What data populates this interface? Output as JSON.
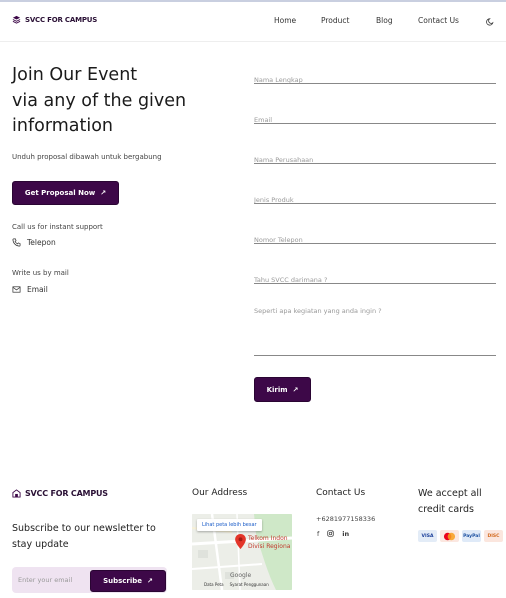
{
  "nav": {
    "brand": "SVCC FOR CAMPUS",
    "links": [
      "Home",
      "Product",
      "Blog",
      "Contact Us"
    ]
  },
  "hero": {
    "title_lines": [
      "Join Our Event",
      "via any of the given",
      "information"
    ],
    "subtitle": "Unduh proposal dibawah untuk bergabung",
    "proposal_button": "Get Proposal Now",
    "call_label": "Call us for instant support",
    "phone_label": "Telepon",
    "mail_label": "Write us by mail",
    "email_label": "Email"
  },
  "form": {
    "placeholders": {
      "name": "Nama Lengkap",
      "email": "Email",
      "company": "Nama Perusahaan",
      "product": "Jenis Produk",
      "phone": "Nomor Telepon",
      "source": "Tahu SVCC darimana ?",
      "activity": "Seperti apa kegiatan yang anda ingin ?"
    },
    "submit_label": "Kirim"
  },
  "footer": {
    "brand": "SVCC FOR CAMPUS",
    "newsletter_title": "Subscribe to our newsletter to stay update",
    "newsletter_placeholder": "Enter your email",
    "subscribe_label": "Subscribe",
    "address_heading": "Our Address",
    "map": {
      "link_label": "Lihat peta lebih besar",
      "place_label_1": "Telkom Indon",
      "place_label_2": "Divisi Regiona",
      "google_label": "Google",
      "footer_items": [
        "Data Peta",
        "Syarat Penggunaan"
      ]
    },
    "contact_heading": "Contact Us",
    "phone_number": "+6281977158336",
    "cards_heading": "We accept all credit cards",
    "cards": [
      {
        "name": "VISA",
        "bg": "#e3ecf7",
        "fg": "#1a3f9a"
      },
      {
        "name": "MC",
        "bg": "#fbe7e0",
        "fg": "#e23b1d"
      },
      {
        "name": "PayPal",
        "bg": "#dfeaf8",
        "fg": "#1a4fa0"
      },
      {
        "name": "DISCOVER",
        "bg": "#fbe6de",
        "fg": "#d2691e"
      }
    ]
  },
  "colors": {
    "accent": "#3d0848",
    "newsletter_bg": "#efe3f1"
  }
}
